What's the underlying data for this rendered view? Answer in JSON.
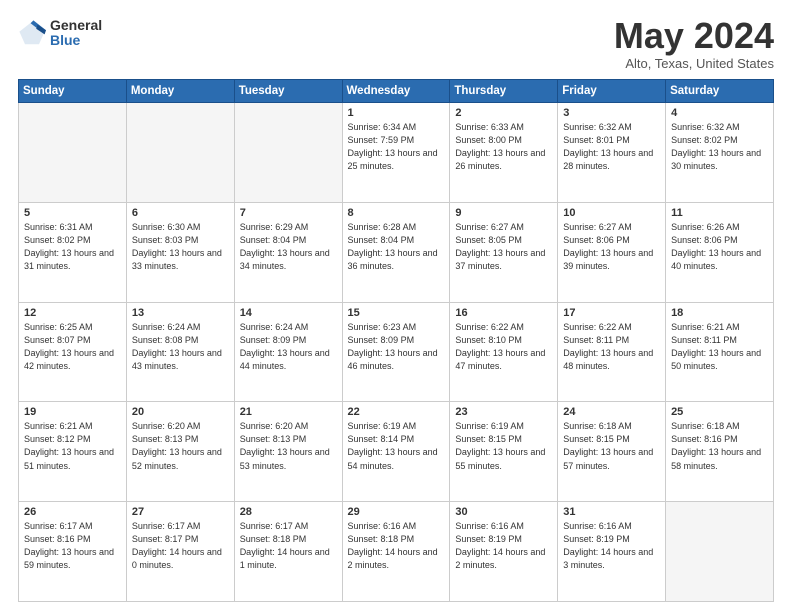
{
  "logo": {
    "general": "General",
    "blue": "Blue"
  },
  "title": "May 2024",
  "location": "Alto, Texas, United States",
  "days_of_week": [
    "Sunday",
    "Monday",
    "Tuesday",
    "Wednesday",
    "Thursday",
    "Friday",
    "Saturday"
  ],
  "weeks": [
    [
      {
        "day": "",
        "empty": true
      },
      {
        "day": "",
        "empty": true
      },
      {
        "day": "",
        "empty": true
      },
      {
        "day": "1",
        "sunrise": "6:34 AM",
        "sunset": "7:59 PM",
        "daylight": "13 hours and 25 minutes."
      },
      {
        "day": "2",
        "sunrise": "6:33 AM",
        "sunset": "8:00 PM",
        "daylight": "13 hours and 26 minutes."
      },
      {
        "day": "3",
        "sunrise": "6:32 AM",
        "sunset": "8:01 PM",
        "daylight": "13 hours and 28 minutes."
      },
      {
        "day": "4",
        "sunrise": "6:32 AM",
        "sunset": "8:02 PM",
        "daylight": "13 hours and 30 minutes."
      }
    ],
    [
      {
        "day": "5",
        "sunrise": "6:31 AM",
        "sunset": "8:02 PM",
        "daylight": "13 hours and 31 minutes."
      },
      {
        "day": "6",
        "sunrise": "6:30 AM",
        "sunset": "8:03 PM",
        "daylight": "13 hours and 33 minutes."
      },
      {
        "day": "7",
        "sunrise": "6:29 AM",
        "sunset": "8:04 PM",
        "daylight": "13 hours and 34 minutes."
      },
      {
        "day": "8",
        "sunrise": "6:28 AM",
        "sunset": "8:04 PM",
        "daylight": "13 hours and 36 minutes."
      },
      {
        "day": "9",
        "sunrise": "6:27 AM",
        "sunset": "8:05 PM",
        "daylight": "13 hours and 37 minutes."
      },
      {
        "day": "10",
        "sunrise": "6:27 AM",
        "sunset": "8:06 PM",
        "daylight": "13 hours and 39 minutes."
      },
      {
        "day": "11",
        "sunrise": "6:26 AM",
        "sunset": "8:06 PM",
        "daylight": "13 hours and 40 minutes."
      }
    ],
    [
      {
        "day": "12",
        "sunrise": "6:25 AM",
        "sunset": "8:07 PM",
        "daylight": "13 hours and 42 minutes."
      },
      {
        "day": "13",
        "sunrise": "6:24 AM",
        "sunset": "8:08 PM",
        "daylight": "13 hours and 43 minutes."
      },
      {
        "day": "14",
        "sunrise": "6:24 AM",
        "sunset": "8:09 PM",
        "daylight": "13 hours and 44 minutes."
      },
      {
        "day": "15",
        "sunrise": "6:23 AM",
        "sunset": "8:09 PM",
        "daylight": "13 hours and 46 minutes."
      },
      {
        "day": "16",
        "sunrise": "6:22 AM",
        "sunset": "8:10 PM",
        "daylight": "13 hours and 47 minutes."
      },
      {
        "day": "17",
        "sunrise": "6:22 AM",
        "sunset": "8:11 PM",
        "daylight": "13 hours and 48 minutes."
      },
      {
        "day": "18",
        "sunrise": "6:21 AM",
        "sunset": "8:11 PM",
        "daylight": "13 hours and 50 minutes."
      }
    ],
    [
      {
        "day": "19",
        "sunrise": "6:21 AM",
        "sunset": "8:12 PM",
        "daylight": "13 hours and 51 minutes."
      },
      {
        "day": "20",
        "sunrise": "6:20 AM",
        "sunset": "8:13 PM",
        "daylight": "13 hours and 52 minutes."
      },
      {
        "day": "21",
        "sunrise": "6:20 AM",
        "sunset": "8:13 PM",
        "daylight": "13 hours and 53 minutes."
      },
      {
        "day": "22",
        "sunrise": "6:19 AM",
        "sunset": "8:14 PM",
        "daylight": "13 hours and 54 minutes."
      },
      {
        "day": "23",
        "sunrise": "6:19 AM",
        "sunset": "8:15 PM",
        "daylight": "13 hours and 55 minutes."
      },
      {
        "day": "24",
        "sunrise": "6:18 AM",
        "sunset": "8:15 PM",
        "daylight": "13 hours and 57 minutes."
      },
      {
        "day": "25",
        "sunrise": "6:18 AM",
        "sunset": "8:16 PM",
        "daylight": "13 hours and 58 minutes."
      }
    ],
    [
      {
        "day": "26",
        "sunrise": "6:17 AM",
        "sunset": "8:16 PM",
        "daylight": "13 hours and 59 minutes."
      },
      {
        "day": "27",
        "sunrise": "6:17 AM",
        "sunset": "8:17 PM",
        "daylight": "14 hours and 0 minutes."
      },
      {
        "day": "28",
        "sunrise": "6:17 AM",
        "sunset": "8:18 PM",
        "daylight": "14 hours and 1 minute."
      },
      {
        "day": "29",
        "sunrise": "6:16 AM",
        "sunset": "8:18 PM",
        "daylight": "14 hours and 2 minutes."
      },
      {
        "day": "30",
        "sunrise": "6:16 AM",
        "sunset": "8:19 PM",
        "daylight": "14 hours and 2 minutes."
      },
      {
        "day": "31",
        "sunrise": "6:16 AM",
        "sunset": "8:19 PM",
        "daylight": "14 hours and 3 minutes."
      },
      {
        "day": "",
        "empty": true
      }
    ]
  ]
}
